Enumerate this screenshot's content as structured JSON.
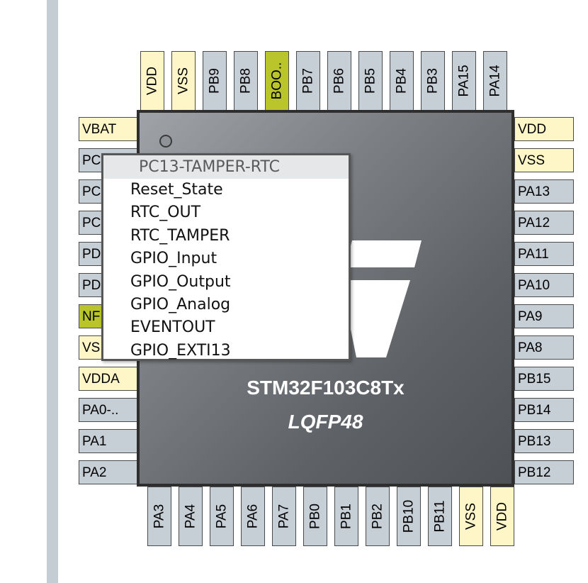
{
  "colors": {
    "pin_default": "#c6ced6",
    "pin_power": "#fff6c8",
    "pin_special": "#b9c52a",
    "chip_body": "#6e7276",
    "chip_text": "#ffffff"
  },
  "chip": {
    "name": "STM32F103C8Tx",
    "package": "LQFP48"
  },
  "pins": {
    "top": [
      "VDD",
      "VSS",
      "PB9",
      "PB8",
      "BOO..",
      "PB7",
      "PB6",
      "PB5",
      "PB4",
      "PB3",
      "PA15",
      "PA14"
    ],
    "top_types": [
      "power",
      "power",
      "normal",
      "normal",
      "special",
      "normal",
      "normal",
      "normal",
      "normal",
      "normal",
      "normal",
      "normal"
    ],
    "left": [
      "VBAT",
      "PC",
      "PC",
      "PC",
      "PD",
      "PD",
      "NF",
      "VS",
      "VDDA",
      "PA0-..",
      "PA1",
      "PA2"
    ],
    "left_types": [
      "power",
      "normal",
      "normal",
      "normal",
      "normal",
      "normal",
      "special",
      "power",
      "power",
      "normal",
      "normal",
      "normal"
    ],
    "right": [
      "VDD",
      "VSS",
      "PA13",
      "PA12",
      "PA11",
      "PA10",
      "PA9",
      "PA8",
      "PB15",
      "PB14",
      "PB13",
      "PB12"
    ],
    "right_types": [
      "power",
      "power",
      "normal",
      "normal",
      "normal",
      "normal",
      "normal",
      "normal",
      "normal",
      "normal",
      "normal",
      "normal"
    ],
    "bottom": [
      "PA3",
      "PA4",
      "PA5",
      "PA6",
      "PA7",
      "PB0",
      "PB1",
      "PB2",
      "PB10",
      "PB11",
      "VSS",
      "VDD"
    ],
    "bottom_types": [
      "normal",
      "normal",
      "normal",
      "normal",
      "normal",
      "normal",
      "normal",
      "normal",
      "normal",
      "normal",
      "power",
      "power"
    ]
  },
  "context_menu": {
    "header": "PC13-TAMPER-RTC",
    "items": [
      "Reset_State",
      "RTC_OUT",
      "RTC_TAMPER",
      "GPIO_Input",
      "GPIO_Output",
      "GPIO_Analog",
      "EVENTOUT",
      "GPIO_EXTI13"
    ]
  }
}
